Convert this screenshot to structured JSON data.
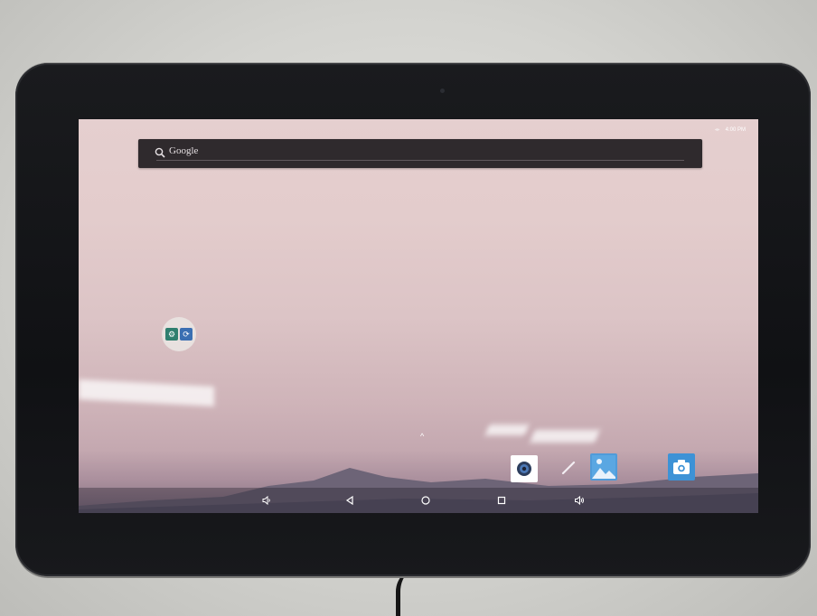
{
  "status_bar": {
    "signal_icon": "signal-arrows-icon",
    "time": "4:00 PM"
  },
  "search_bar": {
    "icon": "search-icon",
    "label": "Google"
  },
  "home_folder": {
    "apps": [
      {
        "icon": "settings-icon",
        "color": "#2f7f6f"
      },
      {
        "icon": "update-icon",
        "color": "#3a6fb2"
      }
    ]
  },
  "app_drawer": {
    "icon": "chevron-up-icon",
    "glyph": "^"
  },
  "dock": {
    "apps": [
      {
        "icon": "camera-lens-icon",
        "color": "#ffffff"
      },
      {
        "icon": "pencil-icon",
        "color": "#ffffff"
      },
      {
        "icon": "gallery-icon",
        "color": "#4f9bd9"
      },
      {
        "icon": "camera-icon",
        "color": "#3d92d6"
      }
    ]
  },
  "nav_bar": {
    "buttons": [
      {
        "icon": "volume-down-icon"
      },
      {
        "icon": "back-icon"
      },
      {
        "icon": "home-icon"
      },
      {
        "icon": "recents-icon"
      },
      {
        "icon": "volume-up-icon"
      }
    ]
  },
  "colors": {
    "wallpaper_top": "#e5cfcf",
    "wallpaper_bottom": "#7f6d80",
    "search_bar": "#2f2a2d",
    "bezel": "#121316"
  }
}
